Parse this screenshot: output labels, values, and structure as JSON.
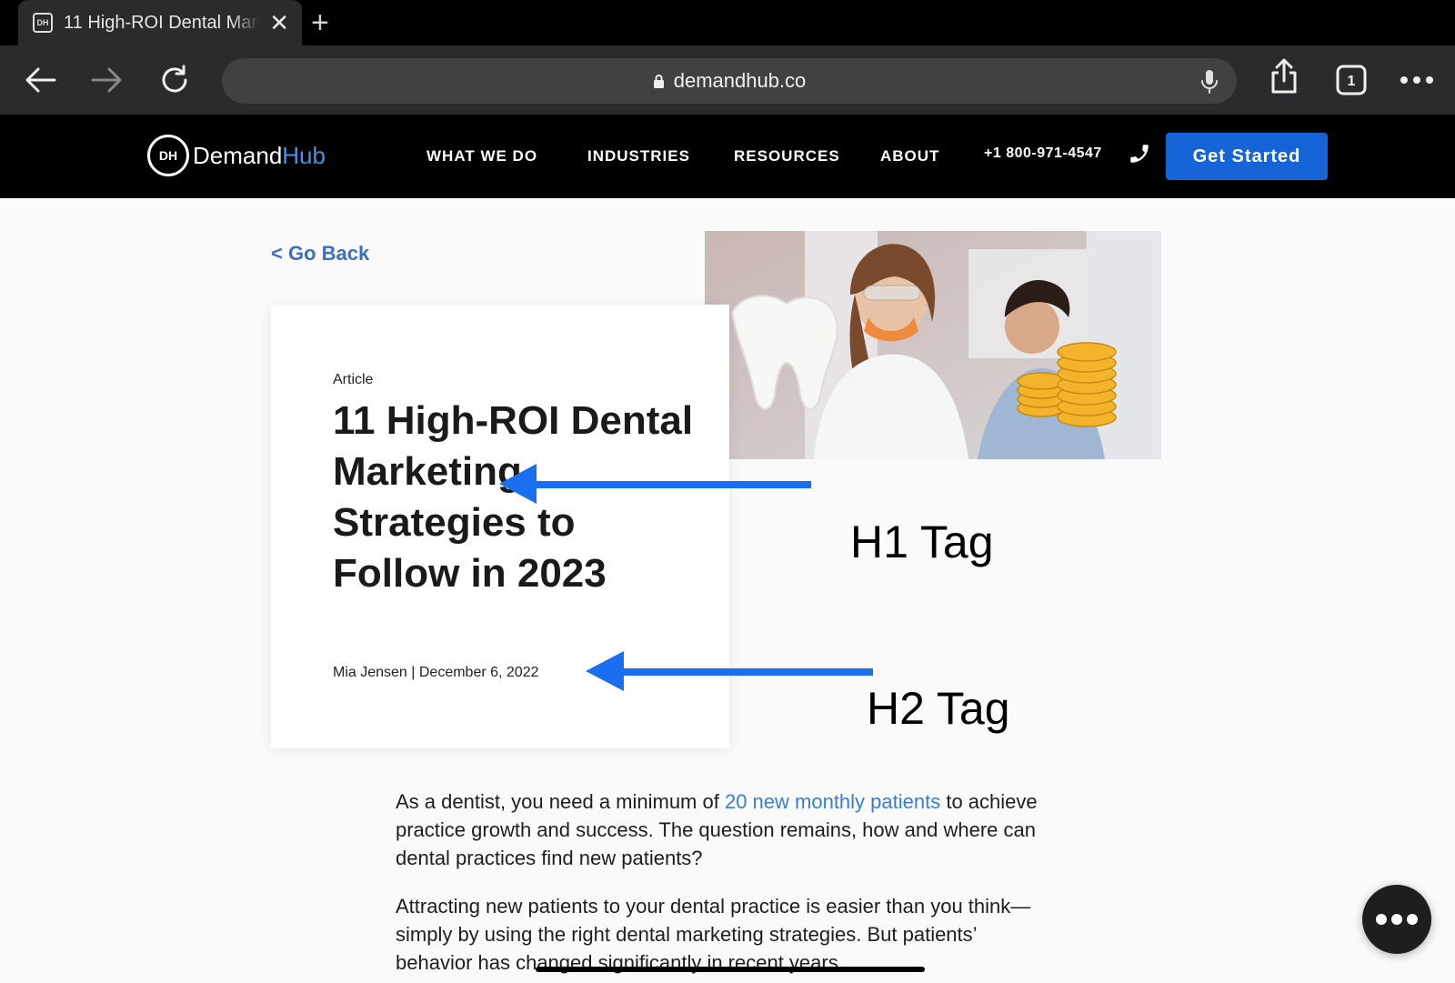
{
  "browser": {
    "tab": {
      "title": "11 High-ROI Dental Marketing Strategies to Follow in 2023",
      "favicon": "DH"
    },
    "url": "demandhub.co",
    "tab_count": "1"
  },
  "site": {
    "logo": {
      "badge": "DH",
      "text_a": "Demand",
      "text_b": "Hub"
    },
    "nav": [
      "WHAT WE DO",
      "INDUSTRIES",
      "RESOURCES",
      "ABOUT"
    ],
    "phone": "+1 800-971-4547",
    "cta": "Get Started"
  },
  "article": {
    "go_back": "< Go Back",
    "label": "Article",
    "title": "11 High-ROI Dental Marketing Strategies to Follow in 2023",
    "meta": "Mia Jensen | December 6, 2022",
    "body": {
      "p1_before": "As a dentist, you need a minimum of ",
      "p1_link": "20 new monthly patients",
      "p1_after": " to achieve practice growth and success. The question remains, how and where can dental practices find new patients?",
      "p2": "Attracting new patients to your dental practice is easier than you think—simply by using the right dental marketing strategies. But patients’ behavior has changed significantly in recent years."
    }
  },
  "annotations": {
    "h1": "H1 Tag",
    "h2": "H2 Tag"
  },
  "colors": {
    "accent": "#1565d8",
    "link": "#3a7dd6",
    "arrow": "#1a6ff0"
  },
  "icons": {
    "back": "arrow-left-icon",
    "forward": "arrow-right-icon",
    "reload": "reload-icon",
    "lock": "lock-icon",
    "mic": "mic-icon",
    "share": "share-icon",
    "tabs": "tabs-icon",
    "more": "more-icon",
    "phone": "phone-icon",
    "chat": "chat-icon"
  }
}
